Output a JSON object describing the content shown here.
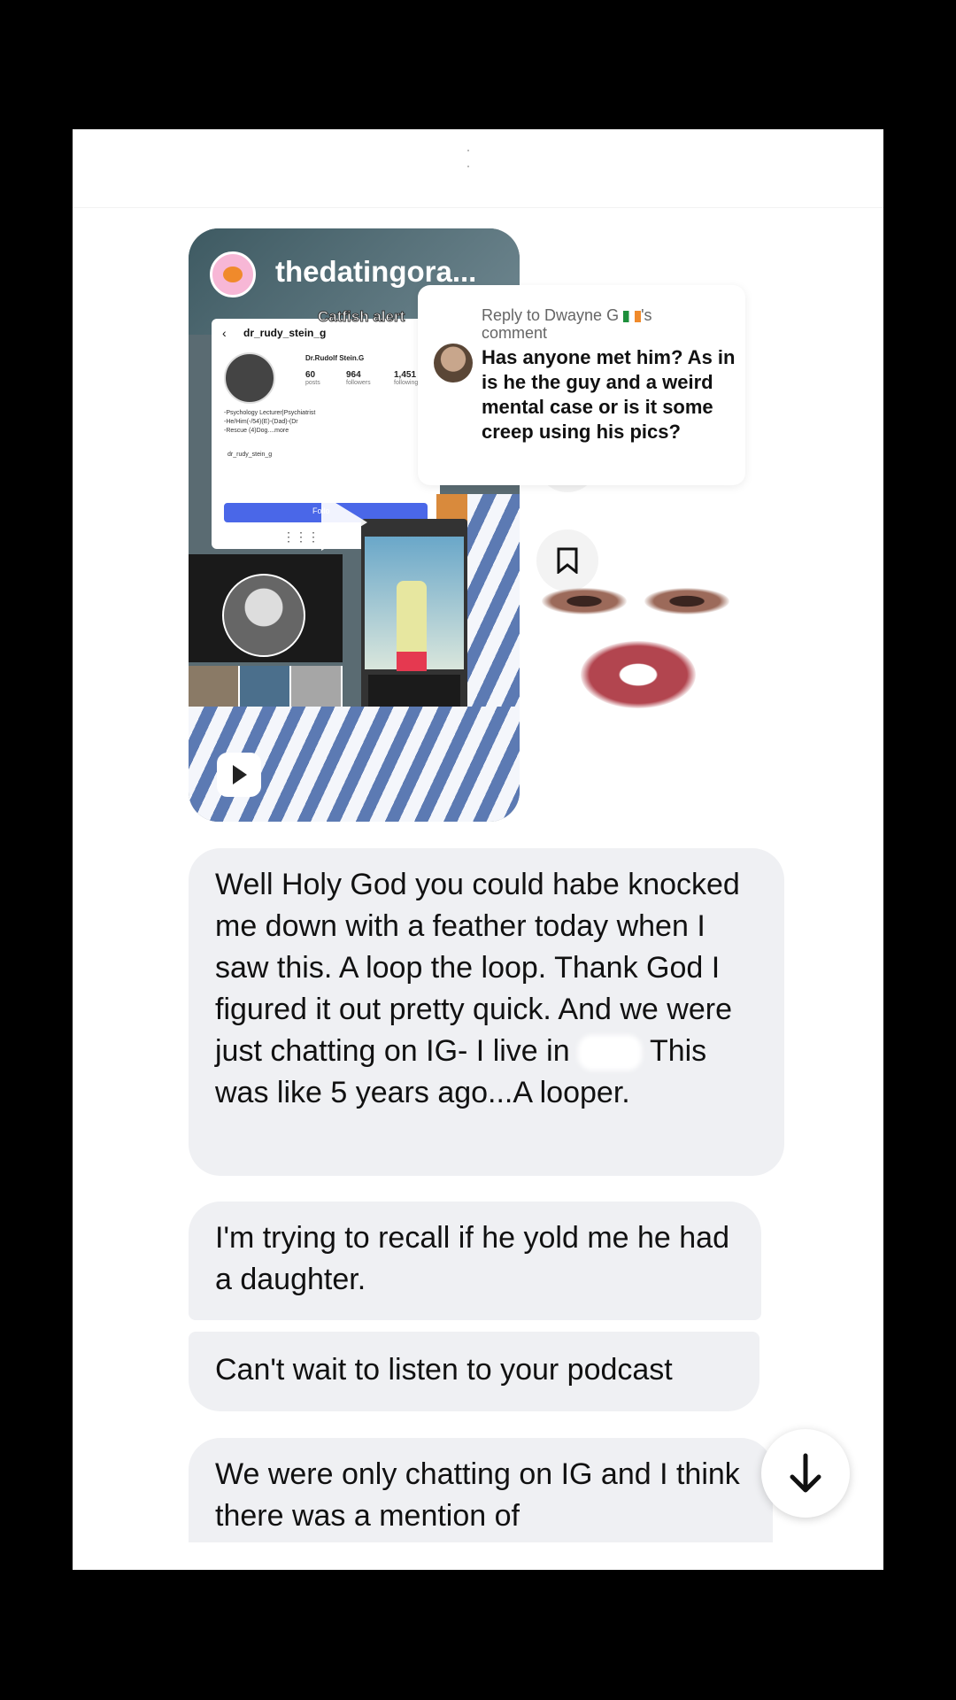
{
  "shared_video": {
    "account_name": "thedatingora...",
    "overlay_label": "Catfish alert",
    "profile": {
      "username": "dr_rudy_stein_g",
      "display_name": "Dr.Rudolf Stein.G",
      "posts": "60",
      "posts_label": "posts",
      "followers": "964",
      "followers_label": "followers",
      "following": "1,451",
      "following_label": "following",
      "bio": "-Psychology Lecturer|Psychiatrist\n-He/Him(-/54)(E)-(Dad)-(Dr\n-Rescue (4)Dog....more",
      "link": "dr_rudy_stein_g",
      "follow_label": "Follo"
    }
  },
  "reply_comment": {
    "reply_to": "Reply to Dwayne G",
    "reply_suffix": "'s comment",
    "text": "Has anyone met him? As in is he the guy and a weird mental case or is it some creep using his pics?"
  },
  "messages": [
    {
      "text_before": "Well Holy God you could habe knocked me down with a feather today when I saw this. A loop the loop. Thank God I figured it out pretty quick. And we were just chatting on IG- I live in",
      "text_after": "This was like 5 years ago...A looper."
    },
    {
      "text": "I'm trying to recall if he yold me he had a daughter."
    },
    {
      "text": "Can't wait to listen to your podcast"
    },
    {
      "text": "We were only chatting on IG and I think there was a mention of"
    }
  ],
  "icons": {
    "bookmark": "bookmark-icon",
    "scroll_down": "arrow-down-icon",
    "play": "play-icon"
  },
  "colors": {
    "bubble": "#eff0f3",
    "follow_button": "#4a67e8",
    "background": "#000000"
  }
}
